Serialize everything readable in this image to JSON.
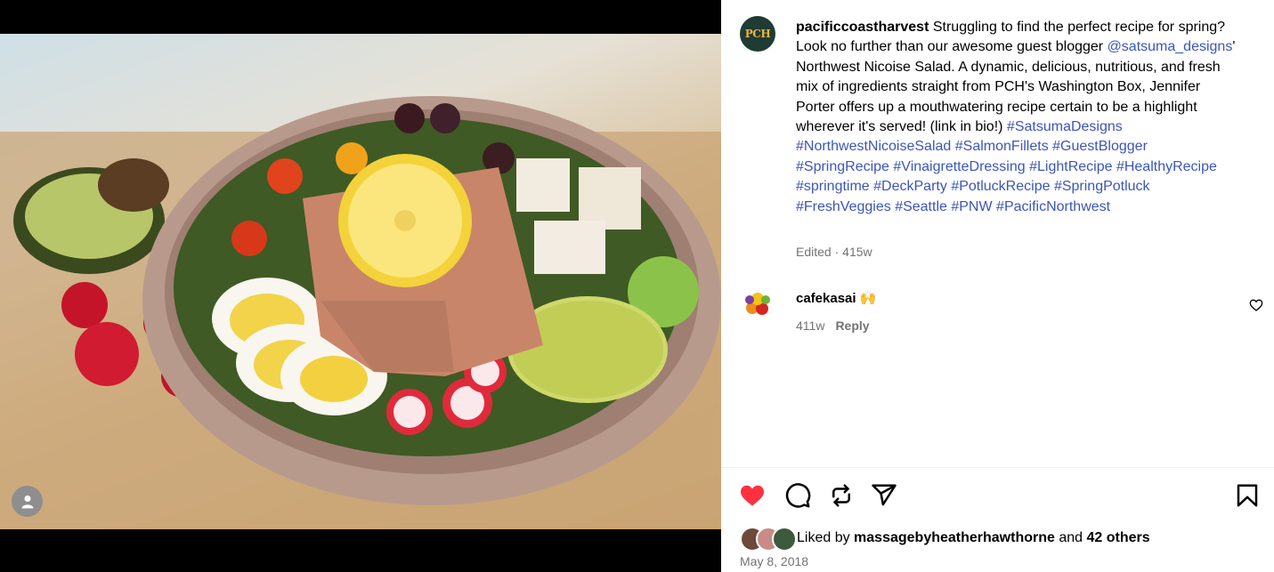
{
  "post": {
    "username": "pacificcoastharvest",
    "avatar_text": "PCH",
    "caption_part1": "Struggling to find the perfect recipe for spring? Look no further than our awesome guest blogger ",
    "mention": "@satsuma_designs",
    "caption_part2": "' Northwest Nicoise Salad. A dynamic, delicious, nutritious, and fresh mix of ingredients straight from PCH's Washington Box, Jennifer Porter offers up a mouthwatering recipe certain to be a highlight wherever it's served! (link in bio!) ",
    "hashtags": [
      "#SatsumaDesigns",
      "#NorthwestNicoiseSalad",
      "#SalmonFillets",
      "#GuestBlogger",
      "#SpringRecipe",
      "#VinaigretteDressing",
      "#LightRecipe",
      "#HealthyRecipe",
      "#springtime",
      "#DeckParty",
      "#PotluckRecipe",
      "#SpringPotluck",
      "#FreshVeggies",
      "#Seattle",
      "#PNW",
      "#PacificNorthwest"
    ],
    "edited_label": "Edited",
    "age": "415w"
  },
  "comment": {
    "username": "cafekasai",
    "text": "🙌",
    "age": "411w",
    "reply_label": "Reply"
  },
  "likes": {
    "prefix": "Liked by ",
    "user": "massagebyheatherhawthorne",
    "middle": " and ",
    "others": "42 others"
  },
  "date": "May 8, 2018",
  "icons": {
    "like": "heart-filled-icon",
    "comment": "comment-icon",
    "repost": "repost-icon",
    "share": "share-icon",
    "save": "bookmark-icon",
    "tag": "user-tag-icon",
    "comment_like": "heart-outline-icon"
  },
  "colors": {
    "like": "#ff3040",
    "link": "#3b56b8",
    "muted": "#737373"
  }
}
